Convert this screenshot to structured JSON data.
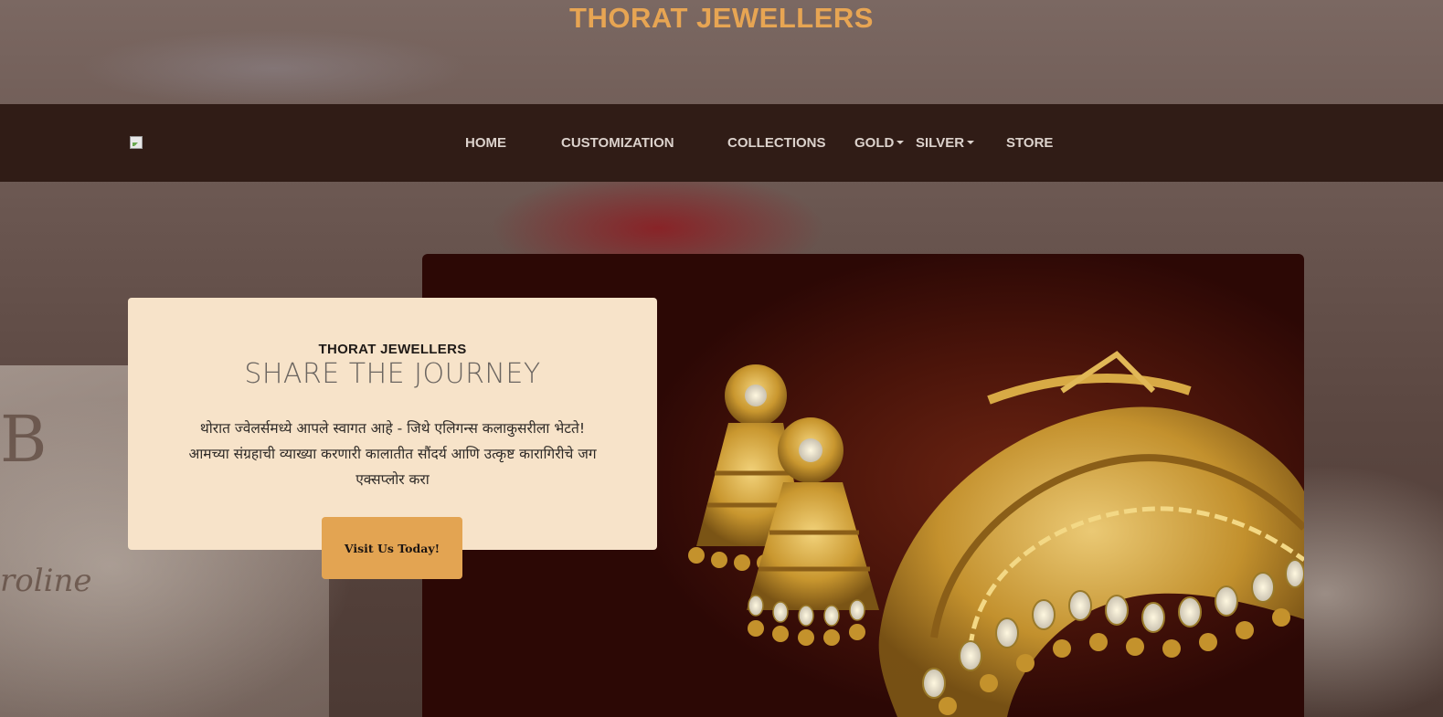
{
  "site": {
    "title": "THORAT JEWELLERS"
  },
  "navbar": {
    "logo_icon": "broken-image-icon",
    "items": [
      {
        "label": "HOME"
      },
      {
        "label": "CUSTOMIZATION"
      },
      {
        "label": "COLLECTIONS"
      },
      {
        "label": "GOLD",
        "dropdown": true
      },
      {
        "label": "SILVER",
        "dropdown": true
      },
      {
        "label": "STORE"
      }
    ]
  },
  "hero": {
    "brand": "THORAT JEWELLERS",
    "tagline": "SHARE THE JOURNEY",
    "description_lines": [
      "थोरात ज्वेलर्समध्ये आपले स्वागत आहे - जिथे एलिगन्स कलाकुसरीला भेटते!",
      "आमच्या संग्रहाची व्याख्या करणारी कालातीत सौंदर्य आणि उत्कृष्ट कारागिरीचे जग",
      "एक्सप्लोर करा"
    ],
    "cta_label": "Visit Us Today!"
  },
  "colors": {
    "accent_gold": "#e7a553",
    "navbar_bg": "#301c16",
    "card_bg": "#f7e3c9",
    "button_bg": "#e3a452"
  }
}
